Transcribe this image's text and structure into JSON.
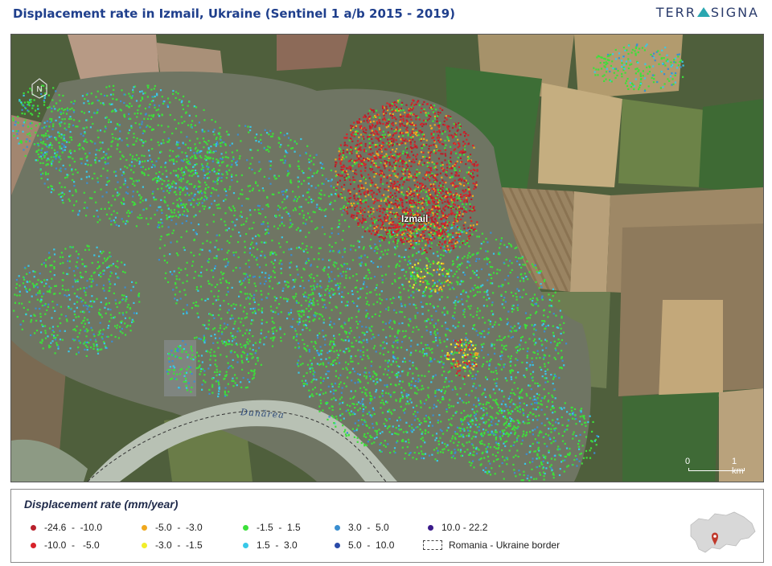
{
  "header": {
    "title": "Displacement rate in Izmail, Ukraine (Sentinel 1 a/b 2015 - 2019)",
    "logo": {
      "left": "TERR",
      "right": "SIGNA"
    }
  },
  "map": {
    "city_label": "Izmail",
    "river_label": "Dunărea",
    "north_icon": "north-arrow-icon",
    "scale": {
      "start": "0",
      "end": "1 km"
    }
  },
  "legend": {
    "title": "Displacement rate (mm/year)",
    "classes": [
      {
        "label": "-24.6  -  -10.0",
        "color": "#b8202c"
      },
      {
        "label": "-10.0  -   -5.0",
        "color": "#d8232a"
      },
      {
        "label": "-5.0  -  -3.0",
        "color": "#f0a81e"
      },
      {
        "label": "-3.0  -  -1.5",
        "color": "#f2ee2a"
      },
      {
        "label": "-1.5  -  1.5",
        "color": "#3ce03a"
      },
      {
        "label": "1.5  -  3.0",
        "color": "#38c8e8"
      },
      {
        "label": "3.0  -  5.0",
        "color": "#3a8ed0"
      },
      {
        "label": "5.0  -  10.0",
        "color": "#2a4aa8"
      },
      {
        "label": "10.0 - 22.2",
        "color": "#3a1a8a"
      }
    ],
    "border_label": "Romania - Ukraine border"
  },
  "colors": {
    "title": "#1f3f8c",
    "field_dark": "#3f5a35",
    "field_brown": "#8a7658",
    "river": "#b9c2b5",
    "inset_marker": "#c0392b"
  }
}
